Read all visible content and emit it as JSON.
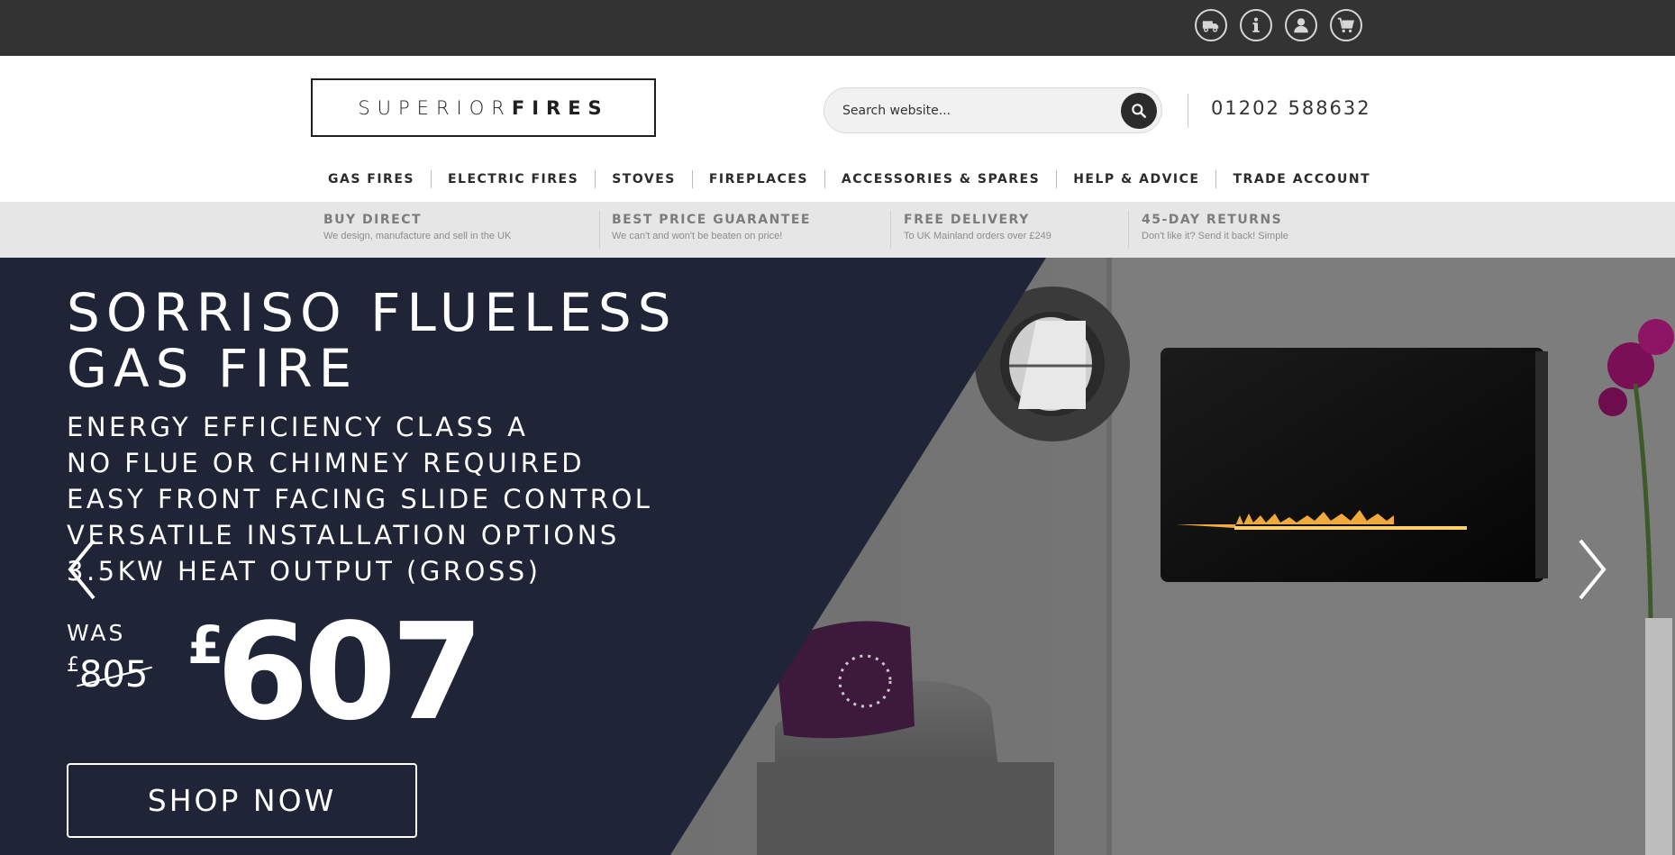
{
  "topbar": {
    "icons": [
      {
        "name": "delivery-truck-icon"
      },
      {
        "name": "info-icon"
      },
      {
        "name": "account-icon"
      },
      {
        "name": "cart-icon"
      }
    ]
  },
  "header": {
    "logo": {
      "light": "SUPERIOR",
      "bold": "FIRES"
    },
    "search": {
      "placeholder": "Search website..."
    },
    "phone": "01202 588632"
  },
  "nav": {
    "items": [
      "GAS FIRES",
      "ELECTRIC FIRES",
      "STOVES",
      "FIREPLACES",
      "ACCESSORIES & SPARES",
      "HELP & ADVICE",
      "TRADE ACCOUNT"
    ]
  },
  "usp": [
    {
      "title": "BUY DIRECT",
      "sub": "We design, manufacture and sell in the UK"
    },
    {
      "title": "BEST PRICE GUARANTEE",
      "sub": "We can't and won't be beaten on price!"
    },
    {
      "title": "FREE DELIVERY",
      "sub": "To UK Mainland orders over £249"
    },
    {
      "title": "45-DAY RETURNS",
      "sub": "Don't like it? Send it back! Simple"
    }
  ],
  "hero": {
    "title_line1": "SORRISO FLUELESS",
    "title_line2": "GAS FIRE",
    "features": [
      "ENERGY EFFICIENCY CLASS A",
      "NO FLUE OR CHIMNEY REQUIRED",
      "EASY FRONT FACING SLIDE CONTROL",
      "VERSATILE INSTALLATION OPTIONS",
      "3.5KW HEAT OUTPUT (GROSS)"
    ],
    "was_label": "WAS",
    "currency": "£",
    "was_price": "805",
    "now_price": "607",
    "cta": "SHOP NOW"
  },
  "colors": {
    "topbar": "#333333",
    "hero_panel": "#1f2436",
    "usp_strip": "#e6e6e6"
  }
}
